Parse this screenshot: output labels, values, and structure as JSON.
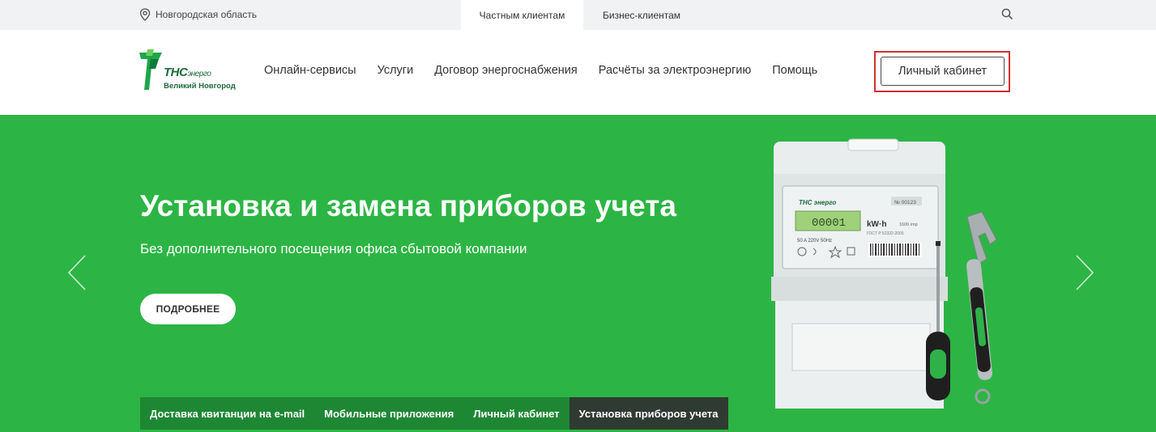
{
  "topbar": {
    "region_label": "Новгородская область",
    "tab_private": "Частным клиентам",
    "tab_business": "Бизнес-клиентам"
  },
  "header": {
    "logo_brand": "ТНС",
    "logo_brand_suffix": "энерго",
    "logo_city": "Великий Новгород",
    "nav": [
      "Онлайн-сервисы",
      "Услуги",
      "Договор энергоснабжения",
      "Расчёты за электроэнергию",
      "Помощь"
    ],
    "cabinet_label": "Личный кабинет"
  },
  "hero": {
    "title": "Установка и замена приборов учета",
    "subtitle": "Без дополнительного посещения офиса сбытовой компании",
    "more_label": "ПОДРОБНЕЕ",
    "meter": {
      "brand": "ТНС энерго",
      "serial": "№ 00123",
      "display": "00001",
      "unit": "kW·h",
      "imp": "1600 imp",
      "gost": "ГОСТ Р 52322-2005",
      "specs": "50 A   220V   50Hz"
    },
    "tabs": [
      "Доставка квитанции на e-mail",
      "Мобильные приложения",
      "Личный кабинет",
      "Установка приборов учета"
    ],
    "active_tab_index": 3
  },
  "colors": {
    "hero_green": "#2cb544",
    "tab_green": "#1e8734",
    "tab_active": "#2f3a33",
    "highlight_red": "#d32f2f",
    "brand_green": "#1d6b3c"
  }
}
